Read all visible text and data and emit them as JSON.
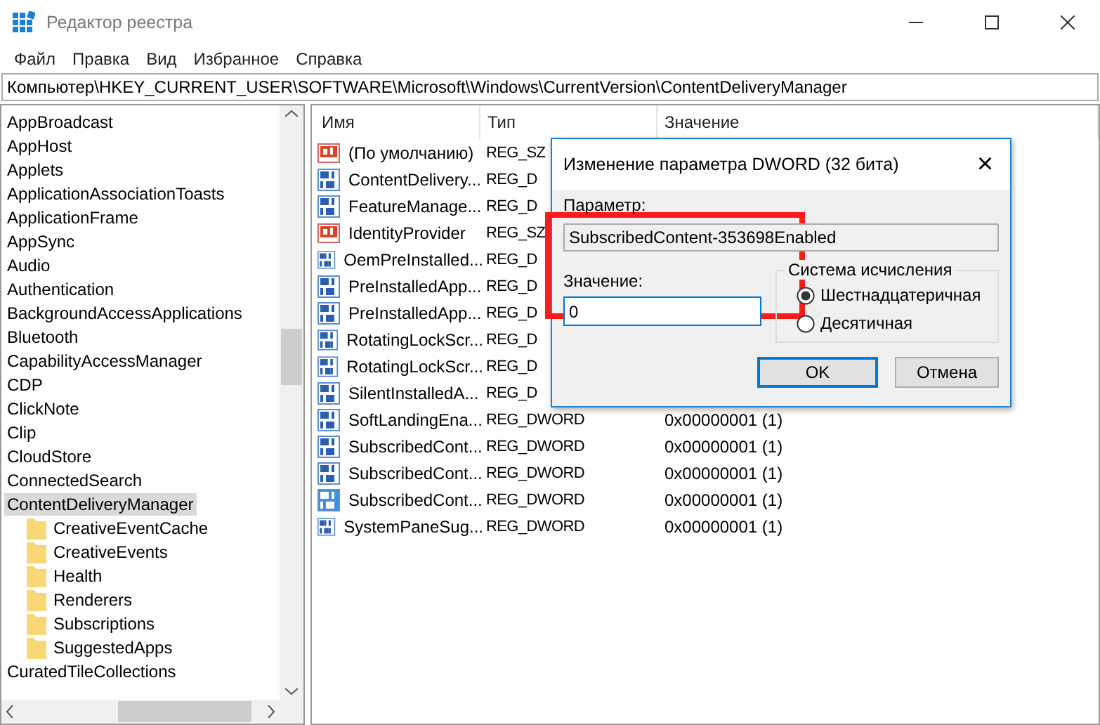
{
  "window": {
    "title": "Редактор реестра"
  },
  "menu": [
    "Файл",
    "Правка",
    "Вид",
    "Избранное",
    "Справка"
  ],
  "address": "Компьютер\\HKEY_CURRENT_USER\\SOFTWARE\\Microsoft\\Windows\\CurrentVersion\\ContentDeliveryManager",
  "tree": [
    {
      "label": "AppBroadcast",
      "selected": false
    },
    {
      "label": "AppHost",
      "selected": false
    },
    {
      "label": "Applets",
      "selected": false
    },
    {
      "label": "ApplicationAssociationToasts",
      "selected": false
    },
    {
      "label": "ApplicationFrame",
      "selected": false
    },
    {
      "label": "AppSync",
      "selected": false
    },
    {
      "label": "Audio",
      "selected": false
    },
    {
      "label": "Authentication",
      "selected": false
    },
    {
      "label": "BackgroundAccessApplications",
      "selected": false
    },
    {
      "label": "Bluetooth",
      "selected": false
    },
    {
      "label": "CapabilityAccessManager",
      "selected": false
    },
    {
      "label": "CDP",
      "selected": false
    },
    {
      "label": "ClickNote",
      "selected": false
    },
    {
      "label": "Clip",
      "selected": false
    },
    {
      "label": "CloudStore",
      "selected": false
    },
    {
      "label": "ConnectedSearch",
      "selected": false
    },
    {
      "label": "ContentDeliveryManager",
      "selected": true,
      "children": [
        {
          "label": "CreativeEventCache",
          "selected": false
        },
        {
          "label": "CreativeEvents",
          "selected": false
        },
        {
          "label": "Health",
          "selected": false
        },
        {
          "label": "Renderers",
          "selected": false
        },
        {
          "label": "Subscriptions",
          "selected": false
        },
        {
          "label": "SuggestedApps",
          "selected": false
        }
      ]
    },
    {
      "label": "CuratedTileCollections",
      "selected": false
    }
  ],
  "list": {
    "columns": [
      "Имя",
      "Тип",
      "Значение"
    ],
    "rows": [
      {
        "kind": "string",
        "name": "(По умолчанию)",
        "type": "REG_SZ",
        "selected": false
      },
      {
        "kind": "binary",
        "name": "ContentDelivery...",
        "type": "REG_D",
        "selected": false
      },
      {
        "kind": "binary",
        "name": "FeatureManage...",
        "type": "REG_D",
        "selected": false
      },
      {
        "kind": "string",
        "name": "IdentityProvider",
        "type": "REG_SZ",
        "selected": false
      },
      {
        "kind": "binary",
        "name": "OemPreInstalled...",
        "type": "REG_D",
        "selected": false
      },
      {
        "kind": "binary",
        "name": "PreInstalledApp...",
        "type": "REG_D",
        "selected": false
      },
      {
        "kind": "binary",
        "name": "PreInstalledApp...",
        "type": "REG_D",
        "selected": false
      },
      {
        "kind": "binary",
        "name": "RotatingLockScr...",
        "type": "REG_D",
        "selected": false
      },
      {
        "kind": "binary",
        "name": "RotatingLockScr...",
        "type": "REG_D",
        "selected": false
      },
      {
        "kind": "binary",
        "name": "SilentInstalledA...",
        "type": "REG_D",
        "selected": false
      },
      {
        "kind": "binary",
        "name": "SoftLandingEna...",
        "type": "REG_DWORD",
        "value": "0x00000001 (1)",
        "selected": false
      },
      {
        "kind": "binary",
        "name": "SubscribedCont...",
        "type": "REG_DWORD",
        "value": "0x00000001 (1)",
        "selected": false
      },
      {
        "kind": "binary",
        "name": "SubscribedCont...",
        "type": "REG_DWORD",
        "value": "0x00000001 (1)",
        "selected": false
      },
      {
        "kind": "binary",
        "name": "SubscribedCont...",
        "type": "REG_DWORD",
        "value": "0x00000001 (1)",
        "selected": true
      },
      {
        "kind": "binary",
        "name": "SystemPaneSug...",
        "type": "REG_DWORD",
        "value": "0x00000001 (1)",
        "selected": false
      }
    ]
  },
  "dialog": {
    "title": "Изменение параметра DWORD (32 бита)",
    "close": "×",
    "param_label": "Параметр:",
    "param_value": "SubscribedContent-353698Enabled",
    "value_label": "Значение:",
    "value": "0",
    "group": "Система исчисления",
    "radios": [
      {
        "label": "Шестнадцатеричная",
        "selected": true
      },
      {
        "label": "Десятичная",
        "selected": false
      }
    ],
    "buttons": [
      {
        "label": "OK",
        "default": true
      },
      {
        "label": "Отмена",
        "default": false
      }
    ]
  }
}
